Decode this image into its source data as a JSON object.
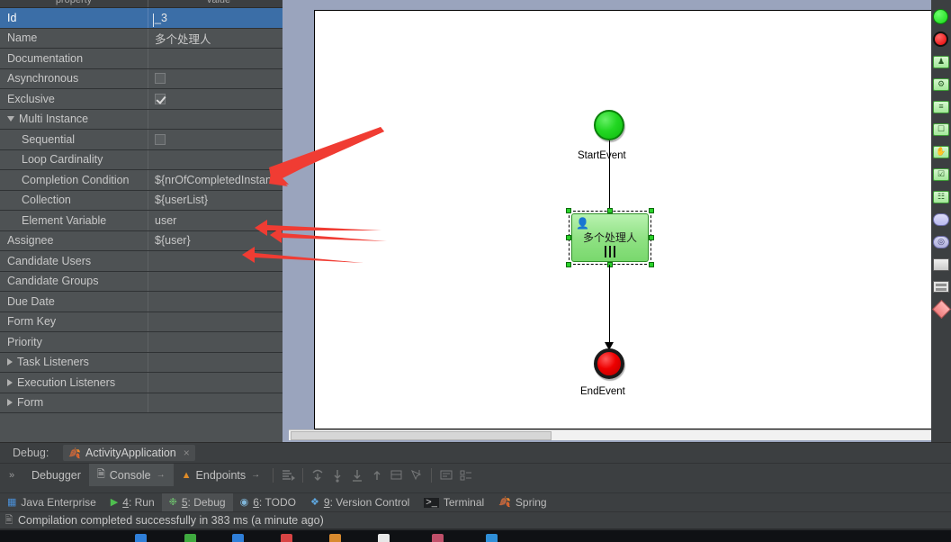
{
  "properties_panel": {
    "columns": [
      "property",
      "value"
    ],
    "rows": [
      {
        "name": "Id",
        "value": "_3",
        "indent": 0,
        "type": "text",
        "selected": true
      },
      {
        "name": "Name",
        "value": "多个处理人",
        "indent": 0,
        "type": "text",
        "selected": false
      },
      {
        "name": "Documentation",
        "value": "",
        "indent": 0,
        "type": "text",
        "selected": false
      },
      {
        "name": "Asynchronous",
        "value": "",
        "indent": 0,
        "type": "checkbox",
        "checked": false,
        "selected": false
      },
      {
        "name": "Exclusive",
        "value": "",
        "indent": 0,
        "type": "checkbox",
        "checked": true,
        "selected": false
      },
      {
        "name": "Multi Instance",
        "value": "",
        "indent": 0,
        "type": "group-open",
        "selected": false
      },
      {
        "name": "Sequential",
        "value": "",
        "indent": 1,
        "type": "checkbox",
        "checked": false,
        "selected": false
      },
      {
        "name": "Loop Cardinality",
        "value": "",
        "indent": 1,
        "type": "text",
        "selected": false
      },
      {
        "name": "Completion Condition",
        "value": "${nrOfCompletedInstanc...",
        "indent": 1,
        "type": "text",
        "selected": false
      },
      {
        "name": "Collection",
        "value": "${userList}",
        "indent": 1,
        "type": "text",
        "selected": false
      },
      {
        "name": "Element Variable",
        "value": "user",
        "indent": 1,
        "type": "text",
        "selected": false
      },
      {
        "name": "Assignee",
        "value": "${user}",
        "indent": 0,
        "type": "text",
        "selected": false
      },
      {
        "name": "Candidate Users",
        "value": "",
        "indent": 0,
        "type": "text",
        "selected": false
      },
      {
        "name": "Candidate Groups",
        "value": "",
        "indent": 0,
        "type": "text",
        "selected": false
      },
      {
        "name": "Due Date",
        "value": "",
        "indent": 0,
        "type": "text",
        "selected": false
      },
      {
        "name": "Form Key",
        "value": "",
        "indent": 0,
        "type": "text",
        "selected": false
      },
      {
        "name": "Priority",
        "value": "",
        "indent": 0,
        "type": "text",
        "selected": false
      },
      {
        "name": "Task Listeners",
        "value": "",
        "indent": 0,
        "type": "group-closed",
        "selected": false
      },
      {
        "name": "Execution Listeners",
        "value": "",
        "indent": 0,
        "type": "group-closed",
        "selected": false
      },
      {
        "name": "Form",
        "value": "",
        "indent": 0,
        "type": "group-closed",
        "selected": false
      }
    ]
  },
  "diagram": {
    "start_event_label": "StartEvent",
    "task_label": "多个处理人",
    "end_event_label": "EndEvent",
    "colors": {
      "start_fill": "#23d723",
      "end_fill": "#ee0000",
      "task_fill": "#8ee182",
      "selection_handle": "#2ad12a"
    }
  },
  "palette": {
    "items": [
      {
        "name": "start-event",
        "shape": "circle-green"
      },
      {
        "name": "end-event",
        "shape": "circle-red"
      },
      {
        "name": "user-task",
        "shape": "rect-green",
        "glyph": "♟"
      },
      {
        "name": "service-task",
        "shape": "rect-green",
        "glyph": "⚙"
      },
      {
        "name": "script-task",
        "shape": "rect-green",
        "glyph": "≡"
      },
      {
        "name": "mail-task",
        "shape": "rect-green",
        "glyph": "✉"
      },
      {
        "name": "manual-task",
        "shape": "rect-green",
        "glyph": "✋"
      },
      {
        "name": "receive-task",
        "shape": "rect-green",
        "glyph": "▣"
      },
      {
        "name": "business-rule-task",
        "shape": "rect-green",
        "glyph": "☷"
      },
      {
        "name": "subprocess",
        "shape": "rect-lavender"
      },
      {
        "name": "call-activity",
        "shape": "rect-lavender2"
      },
      {
        "name": "pool",
        "shape": "rect-gray"
      },
      {
        "name": "lane",
        "shape": "rect-lines"
      },
      {
        "name": "exclusive-gateway",
        "shape": "diamond-red"
      }
    ]
  },
  "annotations": {
    "arrow_color": "#f03c33",
    "arrow_count": 4,
    "targets": [
      "Completion Condition",
      "Collection",
      "Element Variable",
      "Assignee"
    ]
  },
  "debug_panel": {
    "title": "Debug:",
    "configuration": "ActivityApplication",
    "configuration_close": "×",
    "expand_chevron": "»",
    "tabs": [
      {
        "label": "Debugger",
        "active": false,
        "icon": "",
        "pin": ""
      },
      {
        "label": "Console",
        "active": true,
        "icon": "console-icon",
        "pin": "→"
      },
      {
        "label": "Endpoints",
        "active": false,
        "icon": "endpoints-icon",
        "pin": "→"
      }
    ],
    "toolbar_icons": [
      "show-execution-point-icon",
      "step-over-icon",
      "step-into-icon",
      "force-step-into-icon",
      "step-out-icon",
      "drop-frame-icon",
      "run-to-cursor-icon",
      "evaluate-expression-icon",
      "layout-icon"
    ]
  },
  "bottom_tool_buttons": [
    {
      "label": "Java Enterprise",
      "mnemonic": "",
      "icon": "java-enterprise-icon",
      "active": false
    },
    {
      "label": "Run",
      "mnemonic": "4",
      "icon": "run-icon",
      "active": false
    },
    {
      "label": "Debug",
      "mnemonic": "5",
      "icon": "debug-icon",
      "active": true
    },
    {
      "label": "TODO",
      "mnemonic": "6",
      "icon": "todo-icon",
      "active": false
    },
    {
      "label": "Version Control",
      "mnemonic": "9",
      "icon": "version-control-icon",
      "active": false
    },
    {
      "label": "Terminal",
      "mnemonic": "",
      "icon": "terminal-icon",
      "active": false
    },
    {
      "label": "Spring",
      "mnemonic": "",
      "icon": "spring-icon",
      "active": false
    }
  ],
  "status_bar": {
    "icon": "document-icon",
    "message": "Compilation completed successfully in 383 ms (a minute ago)"
  }
}
